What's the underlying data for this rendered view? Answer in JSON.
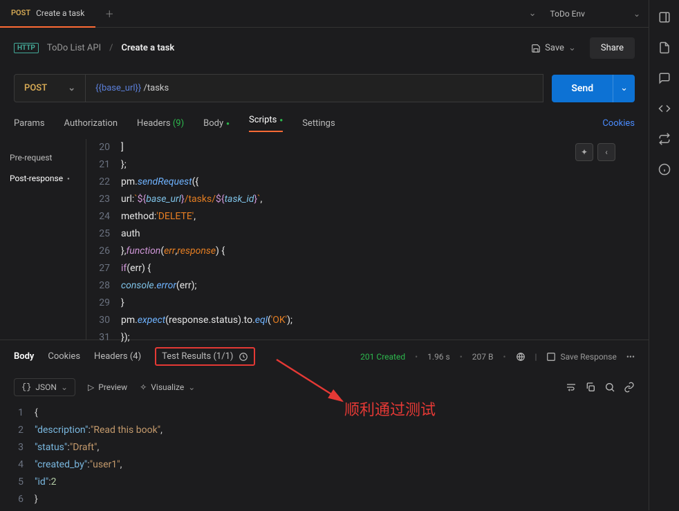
{
  "tab": {
    "method": "POST",
    "title": "Create a task"
  },
  "topbar": {
    "env": "ToDo Env"
  },
  "breadcrumb": {
    "collection": "ToDo List API",
    "request": "Create a task",
    "save": "Save",
    "share": "Share"
  },
  "urlbar": {
    "method": "POST",
    "variable": "{{base_url}}",
    "path": " /tasks",
    "send": "Send"
  },
  "reqTabs": {
    "params": "Params",
    "auth": "Authorization",
    "headers": "Headers ",
    "headersCount": "(9)",
    "body": "Body",
    "scripts": "Scripts",
    "settings": "Settings",
    "cookies": "Cookies"
  },
  "scriptSide": {
    "pre": "Pre-request",
    "post": "Post-response"
  },
  "code": {
    "l20": "    ]",
    "l21": "};",
    "l22a": "pm",
    "l22b": ".",
    "l22c": "sendRequest",
    "l22d": "({",
    "l23a": "    url",
    "l23b": ": ",
    "l23c": "`",
    "l23d": "${",
    "l23e": "base_url",
    "l23f": "}",
    "l23g": "/tasks/",
    "l23h": "${",
    "l23i": "task_id",
    "l23j": "}",
    "l23k": "`",
    "l23l": ",",
    "l24a": "    method",
    "l24b": ": ",
    "l24c": "'DELETE'",
    "l24d": ",",
    "l25": "    auth",
    "l26a": "}, ",
    "l26b": "function",
    "l26c": "(",
    "l26d": "err",
    "l26e": ", ",
    "l26f": "response",
    "l26g": ") {",
    "l27a": "    ",
    "l27b": "if",
    "l27c": "(err) {",
    "l28a": "        ",
    "l28b": "console",
    "l28c": ".",
    "l28d": "error",
    "l28e": "(err);",
    "l29": "    }",
    "l30a": "    pm.",
    "l30b": "expect",
    "l30c": "(response.status).to.",
    "l30d": "eql",
    "l30e": "(",
    "l30f": "'OK'",
    "l30g": ");",
    "l31": "});"
  },
  "respTabs": {
    "body": "Body",
    "cookies": "Cookies",
    "headers": "Headers (4)",
    "testResults": "Test Results (1/1)"
  },
  "respMeta": {
    "status": "201 Created",
    "time": "1.96 s",
    "size": "207 B",
    "save": "Save Response"
  },
  "respToolbar": {
    "json": "JSON",
    "preview": "Preview",
    "visualize": "Visualize"
  },
  "json": {
    "l1": "{",
    "l2k": "\"description\"",
    "l2v": "\"Read this book\"",
    "l3k": "\"status\"",
    "l3v": "\"Draft\"",
    "l4k": "\"created_by\"",
    "l4v": "\"user1\"",
    "l5k": "\"id\"",
    "l5v": "2",
    "l6": "}"
  },
  "annotation": "顺利通过测试",
  "lineNums": {
    "n20": "20",
    "n21": "21",
    "n22": "22",
    "n23": "23",
    "n24": "24",
    "n25": "25",
    "n26": "26",
    "n27": "27",
    "n28": "28",
    "n29": "29",
    "n30": "30",
    "n31": "31"
  },
  "jsonNums": {
    "n1": "1",
    "n2": "2",
    "n3": "3",
    "n4": "4",
    "n5": "5",
    "n6": "6"
  }
}
